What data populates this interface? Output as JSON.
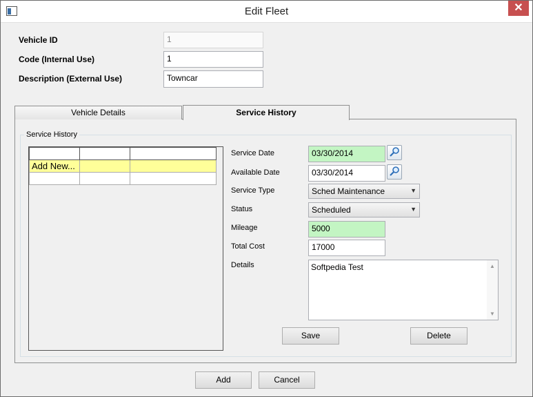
{
  "window": {
    "title": "Edit Fleet"
  },
  "fields": {
    "vehicle_id": {
      "label": "Vehicle ID",
      "value": "1"
    },
    "code": {
      "label": "Code (Internal Use)",
      "value": "1"
    },
    "description": {
      "label": "Description (External Use)",
      "value": "Towncar"
    }
  },
  "tabs": [
    {
      "label": "Vehicle Details",
      "active": false
    },
    {
      "label": "Service History",
      "active": true
    }
  ],
  "service_history": {
    "group_title": "Service History",
    "grid": {
      "rows": [
        [
          "Add New...",
          "",
          ""
        ],
        [
          "",
          "",
          ""
        ]
      ]
    },
    "form": {
      "service_date": {
        "label": "Service Date",
        "value": "03/30/2014"
      },
      "available_date": {
        "label": "Available Date",
        "value": "03/30/2014"
      },
      "service_type": {
        "label": "Service Type",
        "value": "Sched Maintenance"
      },
      "status": {
        "label": "Status",
        "value": "Scheduled"
      },
      "mileage": {
        "label": "Mileage",
        "value": "5000"
      },
      "total_cost": {
        "label": "Total Cost",
        "value": "17000"
      },
      "details": {
        "label": "Details",
        "value": "Softpedia Test"
      }
    },
    "save_label": "Save",
    "delete_label": "Delete"
  },
  "footer": {
    "add_label": "Add",
    "cancel_label": "Cancel"
  },
  "colors": {
    "required_field": "#c3f5c3",
    "selected_row": "#ffff99",
    "close_button": "#c75050"
  }
}
